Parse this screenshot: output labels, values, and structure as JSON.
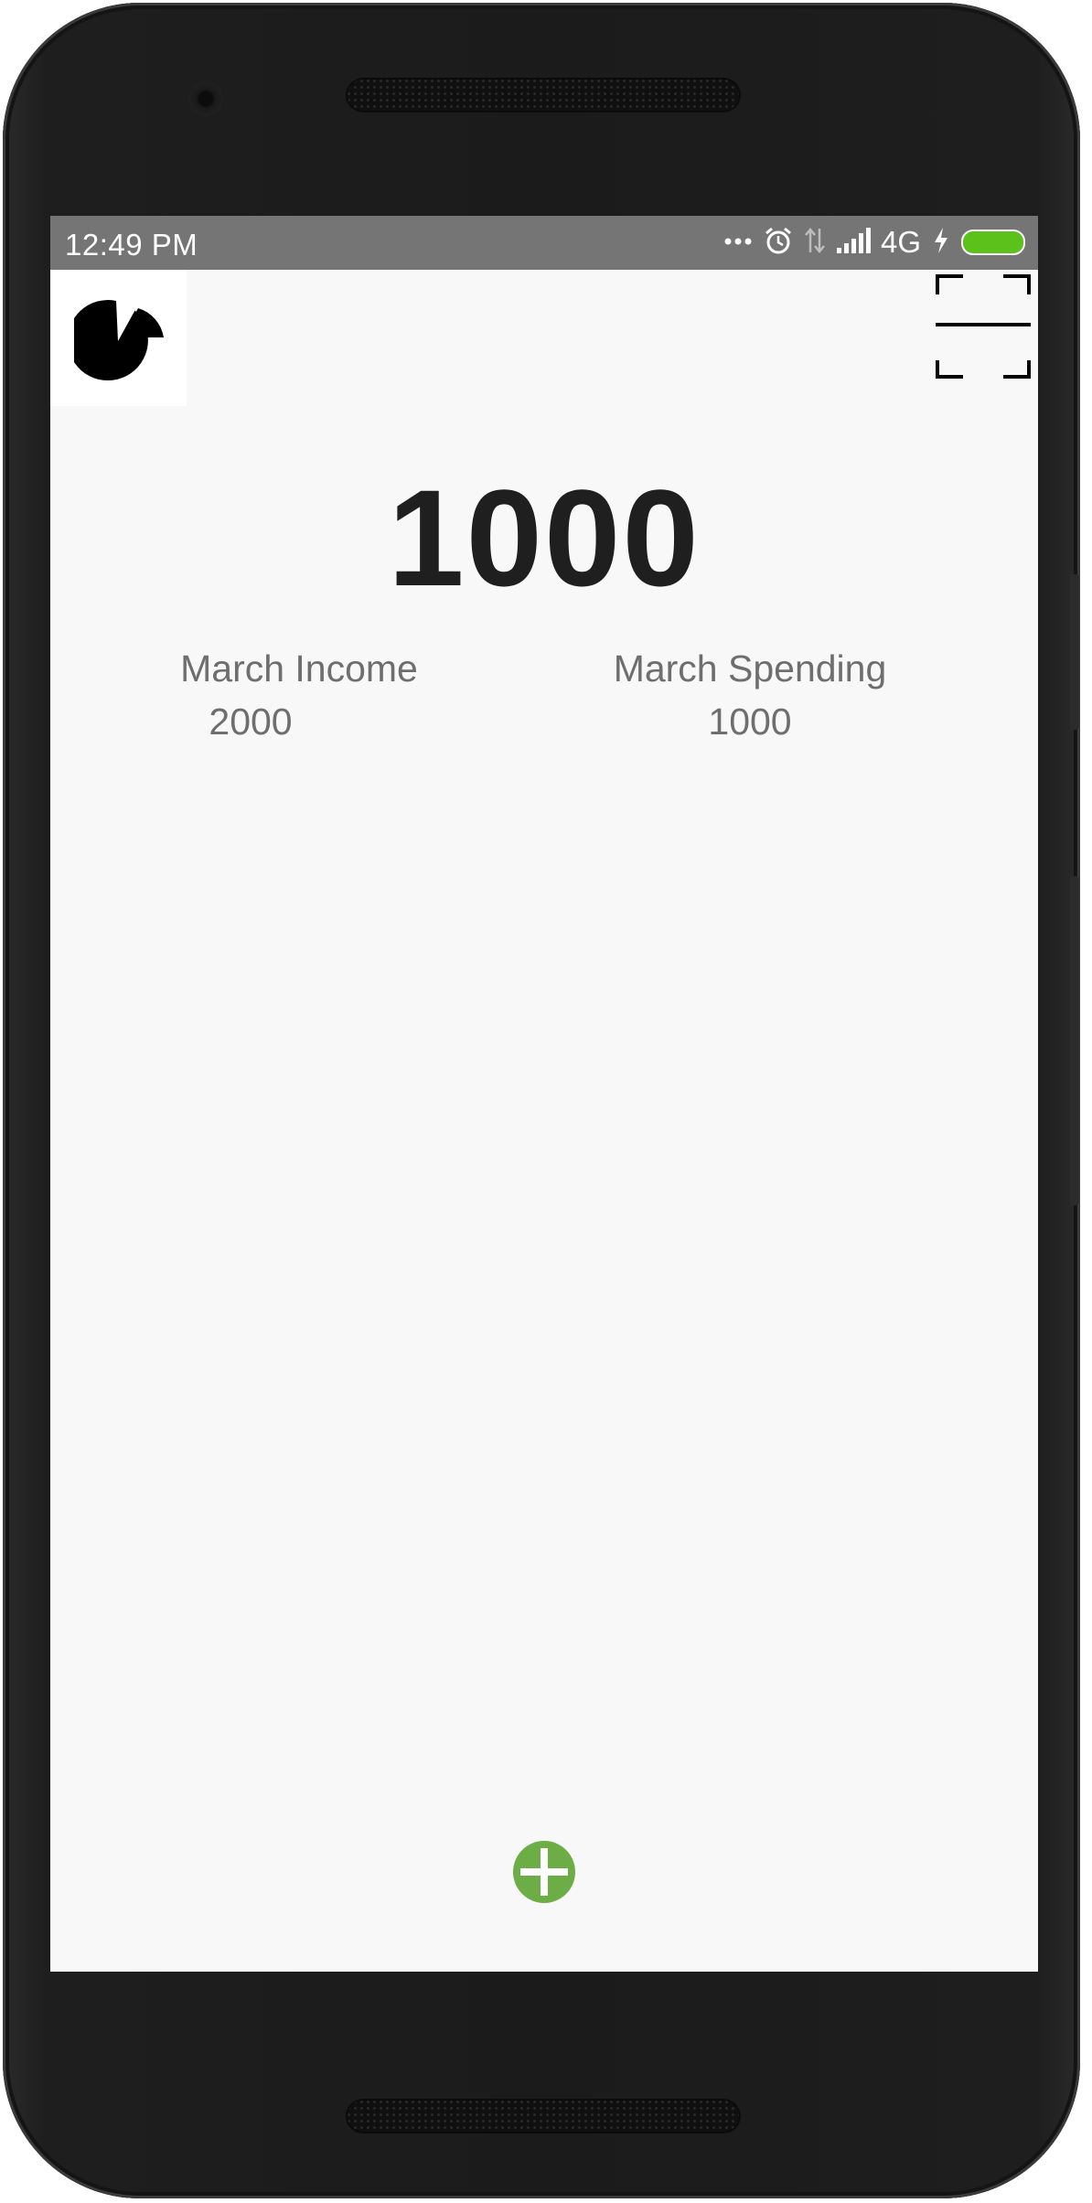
{
  "status_bar": {
    "time": "12:49  PM",
    "network": "4G"
  },
  "header": {
    "logo_icon": "pie-chart-icon",
    "scan_icon": "scan-icon"
  },
  "summary": {
    "balance": "1000",
    "income_label": "March Income",
    "income_value": "2000",
    "spending_label": "March Spending",
    "spending_value": "1000"
  },
  "fab": {
    "icon": "plus-circle-icon",
    "color": "#6cae45"
  },
  "colors": {
    "status_bar_bg": "#757575",
    "battery": "#5cc21b",
    "screen_bg": "#f8f8f8"
  }
}
